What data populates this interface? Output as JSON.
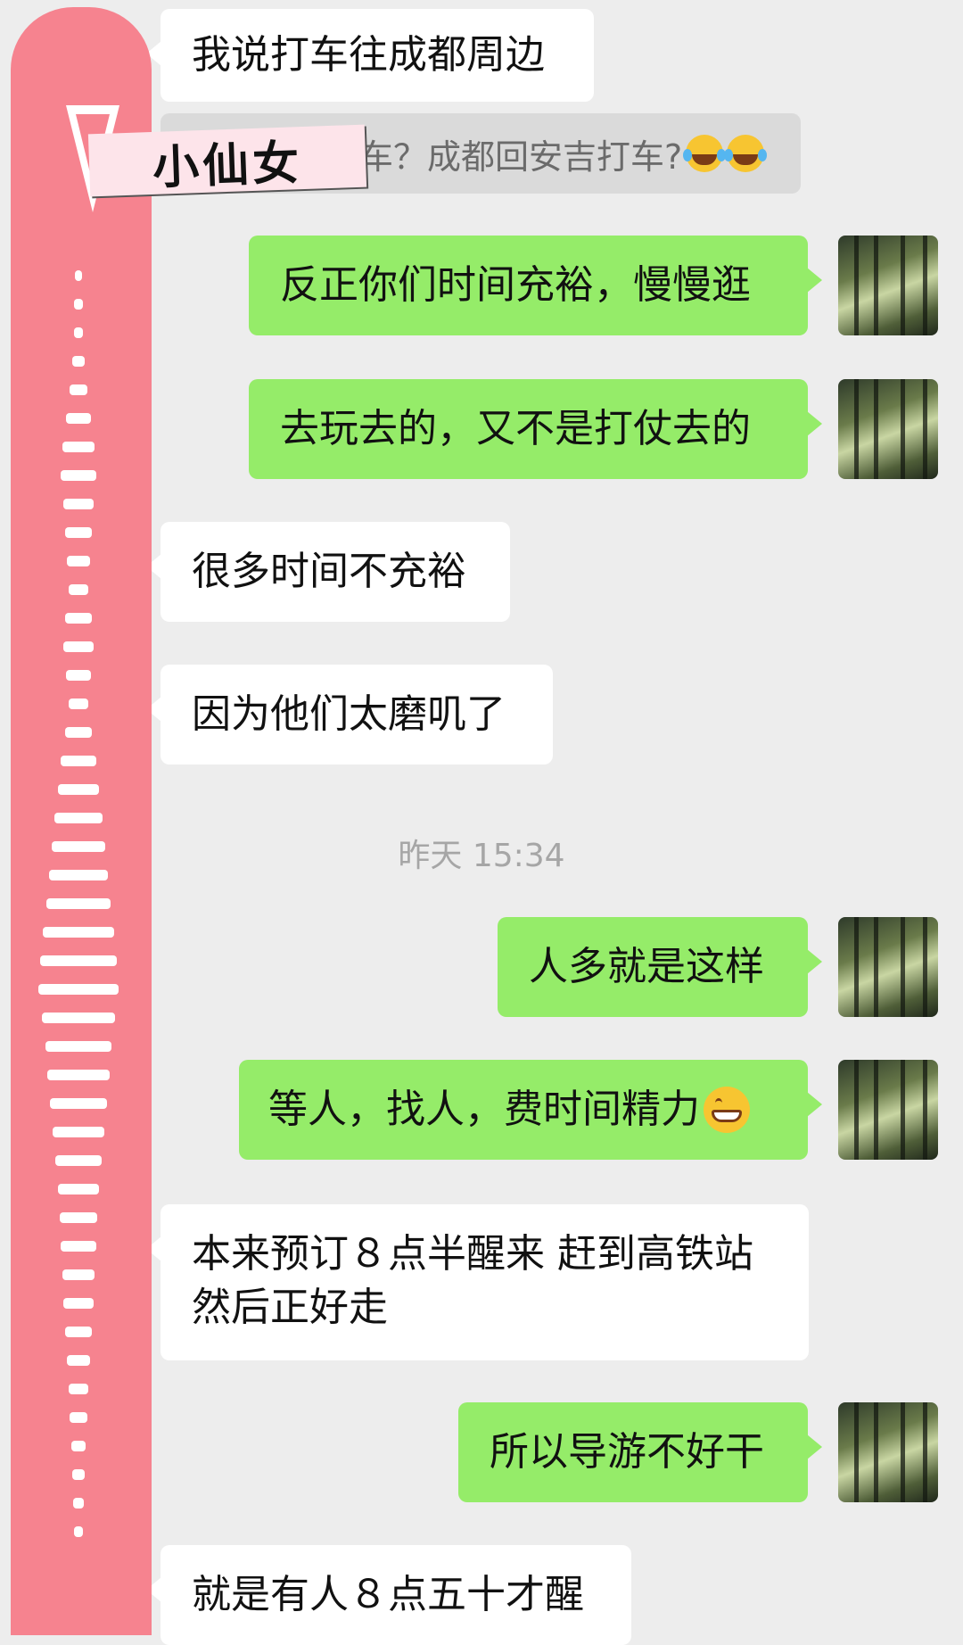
{
  "chat": {
    "messages": [
      {
        "side": "in",
        "text": "我说打车往成都周边"
      },
      {
        "side": "quote",
        "text": "车？成都回安吉打车?"
      },
      {
        "side": "out",
        "text": "反正你们时间充裕，慢慢逛"
      },
      {
        "side": "out",
        "text": "去玩去的，又不是打仗去的"
      },
      {
        "side": "in",
        "text": "很多时间不充裕"
      },
      {
        "side": "in",
        "text": "因为他们太磨叽了"
      },
      {
        "side": "out",
        "text": "人多就是这样"
      },
      {
        "side": "out",
        "text": "等人，找人，费时间精力"
      },
      {
        "side": "in",
        "line1": "本来预订８点半醒来 赶到高铁站",
        "line2": "然后正好走"
      },
      {
        "side": "out",
        "text": "所以导游不好干"
      },
      {
        "side": "in",
        "text": "就是有人８点五十才醒"
      }
    ],
    "timestamp": "昨天 15:34"
  },
  "overlay": {
    "label": "小仙女"
  },
  "emoji": {
    "quote": [
      "laugh-cry-emoji",
      "laugh-cry-emoji"
    ],
    "grin": "grin-emoji"
  },
  "colors": {
    "background": "#ededed",
    "incoming_bubble": "#ffffff",
    "outgoing_bubble": "#95ec69",
    "strip": "#f6838f"
  }
}
